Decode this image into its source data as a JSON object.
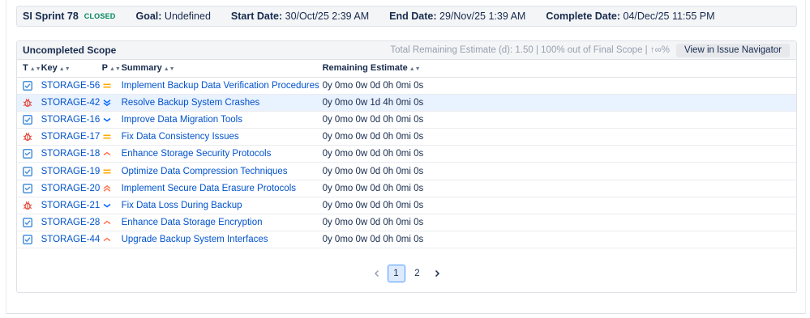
{
  "sprint": {
    "name": "SI Sprint 78",
    "status": "CLOSED",
    "goal_label": "Goal:",
    "goal": "Undefined",
    "start_label": "Start Date:",
    "start": "30/Oct/25 2:39 AM",
    "end_label": "End Date:",
    "end": "29/Nov/25 1:39 AM",
    "complete_label": "Complete Date:",
    "complete": "04/Dec/25 11:55 PM"
  },
  "scope": {
    "title": "Uncompleted Scope",
    "stats": "Total Remaining Estimate (d): 1.50 | 100% out of Final Scope | ↑∞%",
    "navigator_button": "View in Issue Navigator",
    "columns": [
      "T",
      "Key",
      "P",
      "Summary",
      "Remaining Estimate"
    ],
    "rows": [
      {
        "type": "story-icon",
        "key": "STORAGE-56",
        "priority": "medium-priority-icon",
        "summary": "Implement Backup Data Verification Procedures",
        "estimate": "0y 0mo 0w 0d 0h 0mi 0s"
      },
      {
        "type": "bug-icon",
        "key": "STORAGE-42",
        "priority": "lowest-priority-icon",
        "summary": "Resolve Backup System Crashes",
        "estimate": "0y 0mo 0w 1d 4h 0mi 0s"
      },
      {
        "type": "story-icon",
        "key": "STORAGE-16",
        "priority": "low-priority-icon",
        "summary": "Improve Data Migration Tools",
        "estimate": "0y 0mo 0w 0d 0h 0mi 0s"
      },
      {
        "type": "bug-icon",
        "key": "STORAGE-17",
        "priority": "medium-priority-icon",
        "summary": "Fix Data Consistency Issues",
        "estimate": "0y 0mo 0w 0d 0h 0mi 0s"
      },
      {
        "type": "task-icon",
        "key": "STORAGE-18",
        "priority": "high-priority-icon",
        "summary": "Enhance Storage Security Protocols",
        "estimate": "0y 0mo 0w 0d 0h 0mi 0s"
      },
      {
        "type": "story-icon",
        "key": "STORAGE-19",
        "priority": "medium-priority-icon",
        "summary": "Optimize Data Compression Techniques",
        "estimate": "0y 0mo 0w 0d 0h 0mi 0s"
      },
      {
        "type": "task-icon",
        "key": "STORAGE-20",
        "priority": "highest-priority-icon",
        "summary": "Implement Secure Data Erasure Protocols",
        "estimate": "0y 0mo 0w 0d 0h 0mi 0s"
      },
      {
        "type": "bug-icon",
        "key": "STORAGE-21",
        "priority": "low-priority-icon",
        "summary": "Fix Data Loss During Backup",
        "estimate": "0y 0mo 0w 0d 0h 0mi 0s"
      },
      {
        "type": "story-icon",
        "key": "STORAGE-28",
        "priority": "high-priority-icon",
        "summary": "Enhance Data Storage Encryption",
        "estimate": "0y 0mo 0w 0d 0h 0mi 0s"
      },
      {
        "type": "story-icon",
        "key": "STORAGE-44",
        "priority": "high-priority-icon",
        "summary": "Upgrade Backup System Interfaces",
        "estimate": "0y 0mo 0w 0d 0h 0mi 0s"
      }
    ],
    "highlighted_row": 1
  },
  "pagination": {
    "prev_icon": "chevron-left-icon",
    "pages": [
      "1",
      "2"
    ],
    "current": "1",
    "next_icon": "chevron-right-icon"
  },
  "colors": {
    "link": "#0052cc",
    "closed": "#00875a",
    "story": "#4a90d9",
    "bug": "#e5493a",
    "medium": "#ffab00",
    "low": "#0065ff",
    "high": "#ff7452"
  }
}
